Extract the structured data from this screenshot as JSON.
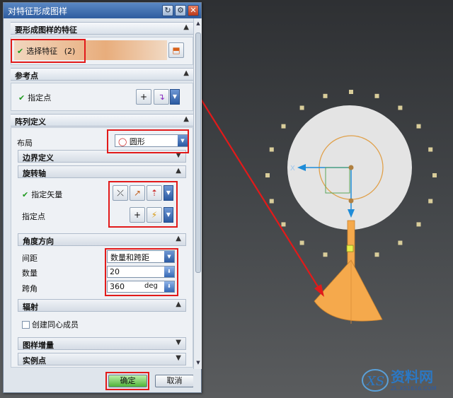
{
  "dialog": {
    "title": "对特征形成图样",
    "sections": {
      "features": {
        "title": "要形成图样的特征",
        "select_label": "选择特征",
        "select_count": "(2)"
      },
      "ref_point": {
        "title": "参考点",
        "specify_point": "指定点"
      },
      "array_def": {
        "title": "阵列定义",
        "layout_label": "布局",
        "layout_value": "圆形",
        "boundary": {
          "title": "边界定义"
        },
        "rotation_axis": {
          "title": "旋转轴",
          "specify_vector": "指定矢量",
          "specify_point": "指定点"
        },
        "angle_direction": {
          "title": "角度方向",
          "spacing_label": "间距",
          "spacing_value": "数量和跨距",
          "count_label": "数量",
          "count_value": "20",
          "span_label": "跨角",
          "span_value": "360",
          "span_unit": "deg"
        },
        "radiation": {
          "title": "辐射",
          "concentric_label": "创建同心成员"
        },
        "increment": {
          "title": "图样增量"
        },
        "instance_point": {
          "title": "实例点"
        }
      }
    },
    "buttons": {
      "ok": "确定",
      "cancel": "取消"
    }
  },
  "viewport": {
    "axis_label": "X",
    "pattern_count": 20,
    "colors": {
      "feature": "#f5a94c",
      "pattern_marker": "#d9cd9a",
      "disk": "#e4e4e4",
      "callout": "#e21a1a"
    }
  },
  "watermark": {
    "brand": "资料网",
    "url": "ZL.XS1616.COM"
  }
}
